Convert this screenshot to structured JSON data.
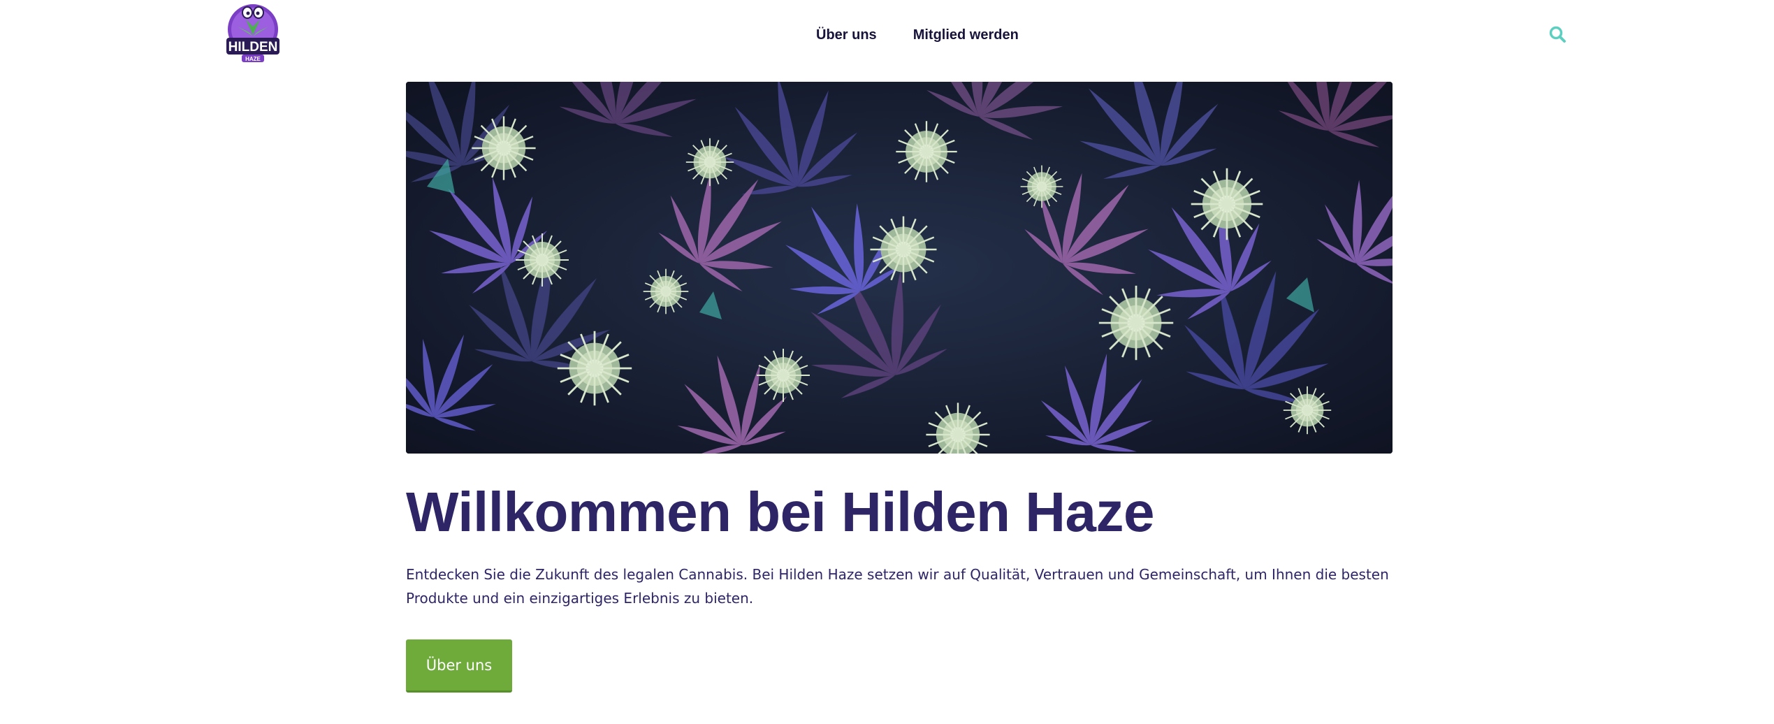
{
  "header": {
    "logo": {
      "text_main": "HILDEN",
      "text_sub": "HAZE"
    },
    "nav": [
      {
        "label": "Über uns"
      },
      {
        "label": "Mitglied werden"
      }
    ],
    "search_icon": "search-icon"
  },
  "hero": {
    "image_alt": "",
    "colors": {
      "leaf_purple": "#6a58b8",
      "leaf_violet": "#8a5c9a",
      "bud_green": "#b9cfae",
      "background": "#161a2c"
    }
  },
  "main": {
    "headline": "Willkommen bei Hilden Haze",
    "intro": "Entdecken Sie die Zukunft des legalen Cannabis. Bei Hilden Haze setzen wir auf Qualität, Vertrauen und Gemeinschaft, um Ihnen die besten Produkte und ein einzigartiges Erlebnis zu bieten.",
    "cta_label": "Über uns"
  },
  "colors": {
    "brand_purple": "#2d2566",
    "accent_teal": "#5ccfc0",
    "cta_green": "#6eab3b"
  }
}
